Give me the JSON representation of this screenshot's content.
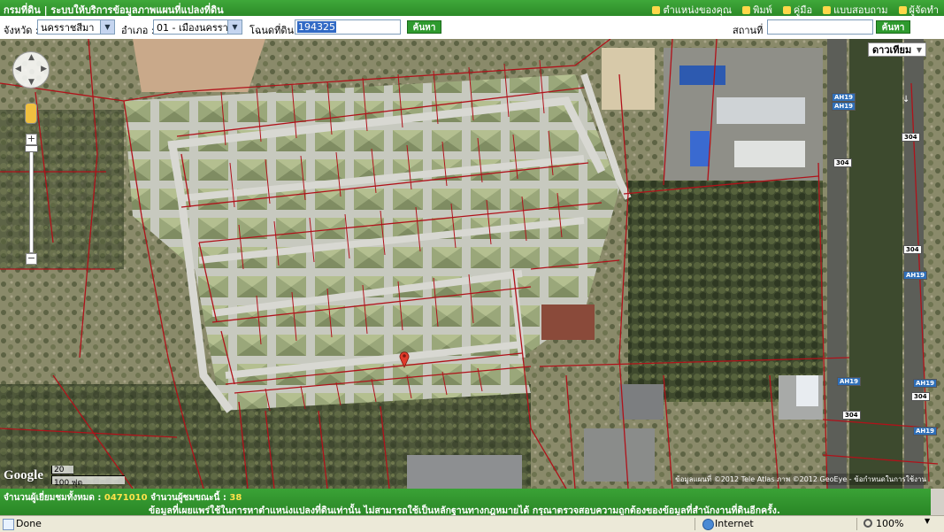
{
  "header": {
    "title": "กรมที่ดิน | ระบบให้บริการข้อมูลภาพแผนที่แปลงที่ดิน",
    "links": [
      {
        "label": "ตำแหน่งของคุณ",
        "icon": "location-person-icon"
      },
      {
        "label": "พิมพ์",
        "icon": "print-icon"
      },
      {
        "label": "คู่มือ",
        "icon": "manual-icon"
      },
      {
        "label": "แบบสอบถาม",
        "icon": "survey-icon"
      },
      {
        "label": "ผู้จัดทำ",
        "icon": "authors-icon"
      }
    ]
  },
  "search": {
    "province_label": "จังหวัด :",
    "province_value": "นครราชสีมา",
    "district_label": "อำเภอ :",
    "district_value": "01 - เมืองนครราชสี",
    "deed_label": "โฉนดที่ดิน :",
    "deed_value": "194325",
    "search_button": "ค้นหา",
    "place_label": "สถานที่ :",
    "place_value": "",
    "place_button": "ค้นหา"
  },
  "map": {
    "map_type": "ดาวเทียม",
    "logo": "Google",
    "scale_top": "20 ม.",
    "scale_bottom": "100 ฟุต",
    "copyright": "ข้อมูลแผนที่ ©2012 Tele Atlas ภาพ ©2012 GeoEye - ข้อกำหนดในการใช้งาน",
    "routes": [
      {
        "label": "AH19",
        "type": "ah"
      },
      {
        "label": "AH19",
        "type": "ah"
      },
      {
        "label": "304",
        "type": "n"
      },
      {
        "label": "304",
        "type": "n"
      },
      {
        "label": "304",
        "type": "n"
      },
      {
        "label": "AH19",
        "type": "ah"
      },
      {
        "label": "AH19",
        "type": "ah"
      },
      {
        "label": "AH19",
        "type": "ah"
      },
      {
        "label": "304",
        "type": "n"
      },
      {
        "label": "304",
        "type": "n"
      },
      {
        "label": "AH19",
        "type": "ah"
      }
    ],
    "colors": {
      "parcel_line": "#b0121a",
      "marker": "#e03a2a"
    }
  },
  "info": {
    "visitors_label": "จำนวนผู้เยี่ยมชมทั้งหมด :",
    "visitors_value": "0471010",
    "online_label": "จำนวนผู้ชมขณะนี้ :",
    "online_value": "38",
    "disclaimer": "ข้อมูลที่เผยแพร่ใช้ในการหาตำแหน่งแปลงที่ดินเท่านั้น ไม่สามารถใช้เป็นหลักฐานทางกฎหมายได้ กรุณาตรวจสอบความถูกต้องของข้อมูลที่สำนักงานที่ดินอีกครั้ง."
  },
  "statusbar": {
    "status": "Done",
    "zone": "Internet",
    "zoom": "100%"
  }
}
